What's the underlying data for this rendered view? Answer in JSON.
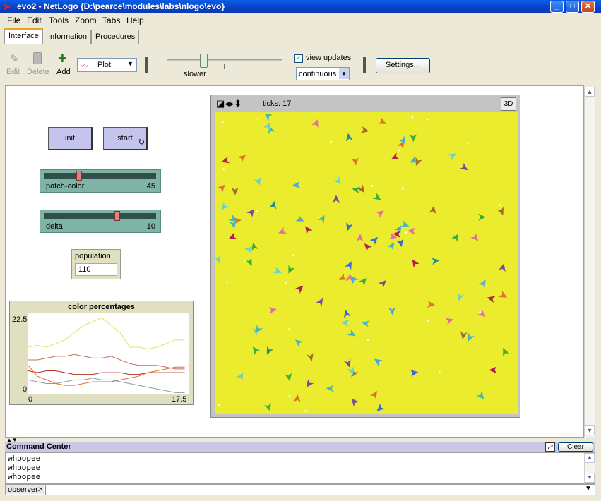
{
  "window": {
    "title": "evo2 - NetLogo {D:\\pearce\\modules\\labs\\nlogo\\evo}",
    "minimize": "_",
    "maximize": "□",
    "close": "✕"
  },
  "menubar": [
    "File",
    "Edit",
    "Tools",
    "Zoom",
    "Tabs",
    "Help"
  ],
  "tabs": [
    "Interface",
    "Information",
    "Procedures"
  ],
  "toolbar": {
    "edit": "Edit",
    "delete": "Delete",
    "add": "Add",
    "widget_type": "Plot",
    "speed_label": "slower",
    "view_updates_label": "view updates",
    "view_updates_checked": true,
    "update_mode": "continuous",
    "settings": "Settings..."
  },
  "widgets": {
    "init": "init",
    "start": "start",
    "sliders": [
      {
        "name": "patch-color",
        "value": "45",
        "fraction": 0.3
      },
      {
        "name": "delta",
        "value": "10",
        "fraction": 0.66
      }
    ],
    "monitor": {
      "label": "population",
      "value": "110"
    }
  },
  "plot": {
    "title": "color percentages",
    "ymax_label": "22.5",
    "ymin_label": "0",
    "xmin_label": "0",
    "xmax_label": "17.5"
  },
  "chart_data": {
    "type": "line",
    "title": "color percentages",
    "xlim": [
      0,
      17.5
    ],
    "ylim": [
      0,
      22.5
    ],
    "series": [
      {
        "color": "#e8e060",
        "x": [
          0,
          1,
          2,
          3,
          4,
          5,
          6,
          7,
          8,
          9,
          10,
          11,
          12,
          13,
          14,
          15,
          16,
          17
        ],
        "y": [
          13,
          13.5,
          13,
          14,
          15,
          17,
          19,
          20,
          21,
          19,
          17,
          13,
          13,
          12.5,
          13,
          14,
          15,
          15
        ]
      },
      {
        "color": "#c0705a",
        "x": [
          0,
          1,
          2,
          3,
          4,
          5,
          6,
          7,
          8,
          9,
          10,
          11,
          12,
          13,
          14,
          15,
          16,
          17
        ],
        "y": [
          9.5,
          9.5,
          10,
          10.5,
          10.5,
          11,
          10.5,
          10,
          10,
          10.5,
          9.5,
          8.5,
          8,
          8,
          8,
          7.5,
          7,
          7
        ]
      },
      {
        "color": "#b03020",
        "x": [
          0,
          1,
          2,
          3,
          4,
          5,
          6,
          7,
          8,
          9,
          10,
          11,
          12,
          13,
          14,
          15,
          16,
          17
        ],
        "y": [
          6.5,
          6,
          6.5,
          6.5,
          6,
          5.5,
          5.5,
          5.5,
          6,
          6,
          6,
          5.5,
          5.5,
          6,
          6,
          6,
          6,
          6
        ]
      },
      {
        "color": "#e07030",
        "x": [
          0,
          1,
          2,
          3,
          4,
          5,
          6,
          7,
          8,
          9,
          10,
          11,
          12,
          13,
          14,
          15,
          16,
          17
        ],
        "y": [
          8,
          5,
          4,
          3,
          2.5,
          2.5,
          3,
          3.5,
          3.5,
          3.5,
          4,
          4.5,
          5,
          6,
          6.5,
          7,
          7.5,
          7.5
        ]
      },
      {
        "color": "#9098a8",
        "x": [
          0,
          1,
          2,
          3,
          4,
          5,
          6,
          7,
          8,
          9,
          10,
          11,
          12,
          13,
          14,
          15,
          16,
          17
        ],
        "y": [
          4,
          3.5,
          3,
          3,
          3.5,
          4,
          4,
          4.5,
          4,
          4,
          3.5,
          3,
          2.5,
          2,
          1.5,
          1,
          0.5,
          0.5
        ]
      }
    ]
  },
  "view": {
    "ticks": "ticks: 17",
    "three_d": "3D"
  },
  "command_center": {
    "title": "Command Center",
    "clear": "Clear",
    "output": [
      "whoopee",
      "whoopee",
      "whoopee"
    ],
    "prompt": "observer>"
  }
}
